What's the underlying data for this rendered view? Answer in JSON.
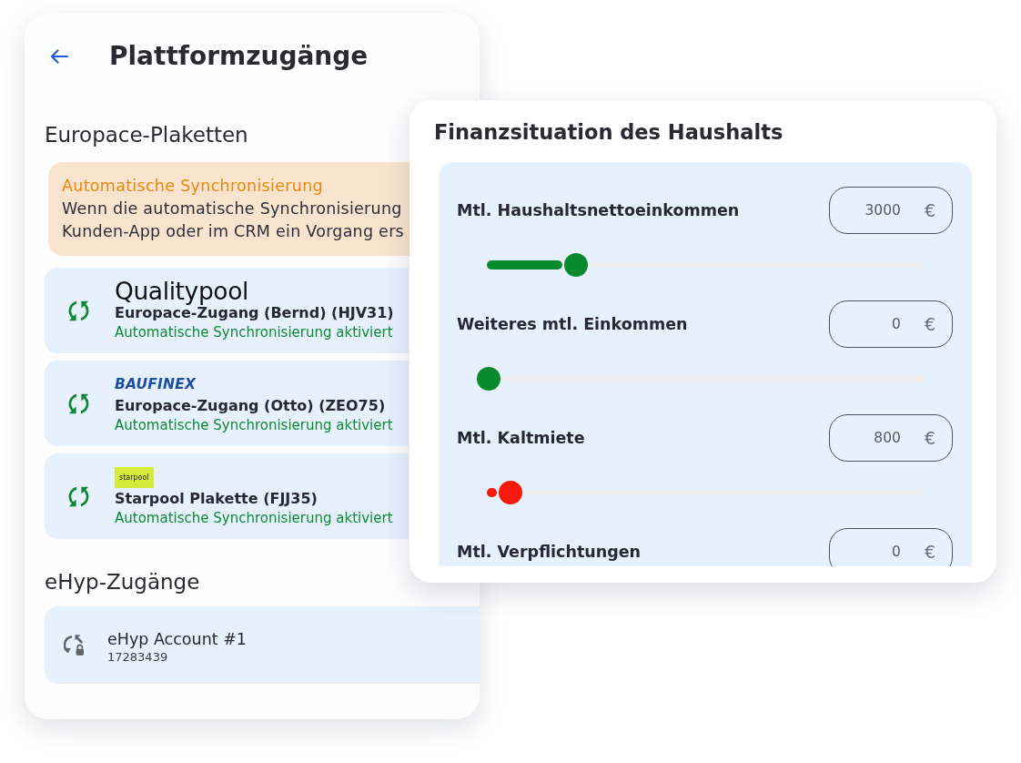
{
  "accounts_screen": {
    "title": "Plattformzugänge",
    "europace_section": {
      "heading": "Europace-Plaketten",
      "notice": {
        "title": "Automatische Synchronisierung",
        "text": "Wenn die automatische Synchronisierung\nKunden-App oder im CRM ein Vorgang ers"
      },
      "badges": [
        {
          "logo": {
            "kind": "wordmark",
            "text": "Qualitypool"
          },
          "name": "Europace-Zugang (Bernd) (HJV31)",
          "status": "Automatische Synchronisierung aktiviert"
        },
        {
          "logo": {
            "kind": "script",
            "text": "BAUFINEX"
          },
          "name": "Europace-Zugang (Otto) (ZEO75)",
          "status": "Automatische Synchronisierung aktiviert"
        },
        {
          "logo": {
            "kind": "tile",
            "text": "starpool"
          },
          "name": "Starpool Plakette (FJJ35)",
          "status": "Automatische Synchronisierung aktiviert"
        }
      ]
    },
    "ehyp_section": {
      "heading": "eHyp-Zugänge",
      "accounts": [
        {
          "name": "eHyp Account #1",
          "number": "17283439"
        }
      ]
    }
  },
  "finance_card": {
    "title": "Finanzsituation des Haushalts",
    "fields": [
      {
        "label": "Mtl. Haushaltsnettoeinkommen",
        "value": "3000",
        "unit": "€",
        "slider": {
          "level": 0.2,
          "color": "#0a8a2e"
        }
      },
      {
        "label": "Weiteres mtl. Einkommen",
        "value": "0",
        "unit": "€",
        "slider": {
          "level": 0,
          "color": "#0a8a2e"
        }
      },
      {
        "label": "Mtl. Kaltmiete",
        "value": "800",
        "unit": "€",
        "slider": {
          "level": 0.05,
          "color": "#f71a0a"
        }
      },
      {
        "label": "Mtl. Verpflichtungen",
        "value": "0",
        "unit": "€"
      }
    ]
  }
}
